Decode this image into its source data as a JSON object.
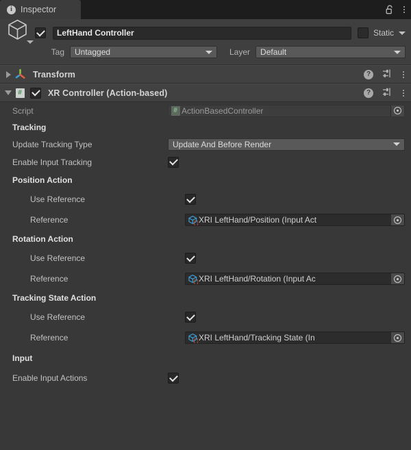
{
  "window": {
    "tab": {
      "label": "Inspector",
      "icon": "info-icon"
    },
    "lock_icon": "lock-open-icon",
    "menu_icon": "kebab-menu-icon"
  },
  "gameobject": {
    "icon": "cube-icon",
    "enabled_checkbox": "checked",
    "name": "LeftHand Controller",
    "static_label": "Static",
    "static_checked": false,
    "tag_label": "Tag",
    "tag_value": "Untagged",
    "layer_label": "Layer",
    "layer_value": "Default"
  },
  "components": [
    {
      "title": "Transform",
      "icon": "transform-axis-icon",
      "expanded": false,
      "has_enable_checkbox": false,
      "help_icon": "help-icon",
      "preset_icon": "preset-sliders-icon",
      "menu_icon": "kebab-menu-icon"
    },
    {
      "title": "XR Controller (Action-based)",
      "icon": "script-icon",
      "expanded": true,
      "has_enable_checkbox": true,
      "enabled": true,
      "help_icon": "help-icon",
      "preset_icon": "preset-sliders-icon",
      "menu_icon": "kebab-menu-icon"
    }
  ],
  "properties": {
    "script": {
      "label": "Script",
      "value": "ActionBasedController",
      "icon": "script-icon",
      "picker_icon": "object-picker-icon"
    },
    "tracking_header": "Tracking",
    "update_tracking_type": {
      "label": "Update Tracking Type",
      "value": "Update And Before Render"
    },
    "enable_input_tracking": {
      "label": "Enable Input Tracking",
      "checked": true
    },
    "position_action": {
      "header": "Position Action",
      "use_reference_label": "Use Reference",
      "use_reference_checked": true,
      "reference_label": "Reference",
      "reference_value": "XRI LeftHand/Position (Input Act",
      "reference_icon": "input-action-reference-icon",
      "picker_icon": "object-picker-icon"
    },
    "rotation_action": {
      "header": "Rotation Action",
      "use_reference_label": "Use Reference",
      "use_reference_checked": true,
      "reference_label": "Reference",
      "reference_value": "XRI LeftHand/Rotation (Input Ac",
      "reference_icon": "input-action-reference-icon",
      "picker_icon": "object-picker-icon"
    },
    "tracking_state_action": {
      "header": "Tracking State Action",
      "use_reference_label": "Use Reference",
      "use_reference_checked": true,
      "reference_label": "Reference",
      "reference_value": "XRI LeftHand/Tracking State (In",
      "reference_icon": "input-action-reference-icon",
      "picker_icon": "object-picker-icon"
    },
    "input_header": "Input",
    "enable_input_actions": {
      "label": "Enable Input Actions",
      "checked": true
    }
  },
  "colors": {
    "window_bg": "#383838",
    "header_bg": "#3f3f3f",
    "component_header_bg": "#414141",
    "tabbar_bg": "#1d1d1d",
    "tab_bg": "#3c3c3c",
    "field_bg": "#2c2c2c",
    "dropdown_bg": "#595959",
    "text": "#c2c2c2",
    "accent_green": "#3f8f4f",
    "accent_blue": "#3d9fd6",
    "accent_orange": "#e2603c"
  }
}
